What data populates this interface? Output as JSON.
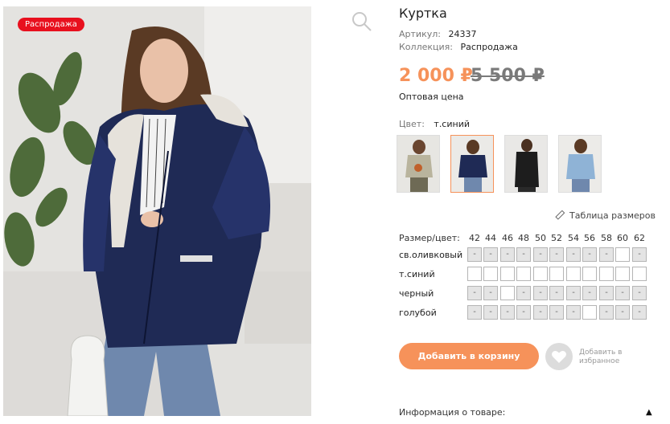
{
  "badge": "Распродажа",
  "product": {
    "title": "Куртка",
    "article_label": "Артикул:",
    "article_value": "24337",
    "collection_label": "Коллекция:",
    "collection_value": "Распродажа",
    "price": "2 000 ₽",
    "old_price": "5 500 ₽",
    "wholesale": "Оптовая цена",
    "color_label": "Цвет:",
    "color_value": "т.синий"
  },
  "size_table_link": "Таблица размеров",
  "size_grid": {
    "header": "Размер/цвет:",
    "sizes": [
      "42",
      "44",
      "46",
      "48",
      "50",
      "52",
      "54",
      "56",
      "58",
      "60",
      "62"
    ],
    "rows": [
      {
        "label": "св.оливковый",
        "cells": [
          "-",
          "-",
          "-",
          "-",
          "-",
          "-",
          "-",
          "-",
          "-",
          "",
          "-"
        ]
      },
      {
        "label": "т.синий",
        "cells": [
          "",
          "",
          "",
          "",
          "",
          "",
          "",
          "",
          "",
          "",
          ""
        ]
      },
      {
        "label": "черный",
        "cells": [
          "-",
          "-",
          "",
          "-",
          "-",
          "-",
          "-",
          "-",
          "-",
          "-",
          "-"
        ]
      },
      {
        "label": "голубой",
        "cells": [
          "-",
          "-",
          "-",
          "-",
          "-",
          "-",
          "-",
          "",
          "-",
          "-",
          "-"
        ]
      }
    ]
  },
  "actions": {
    "add_to_cart": "Добавить в корзину",
    "favorite_line1": "Добавить в",
    "favorite_line2": "избранное"
  },
  "info_label": "Информация о товаре:",
  "info_arrow": "▲",
  "colors": {
    "accent": "#f6925a",
    "badge": "#e8101e",
    "navy": "#1f2a55"
  },
  "icons": [
    "search-icon",
    "ruler-icon",
    "heart-icon",
    "caret-up-icon"
  ]
}
